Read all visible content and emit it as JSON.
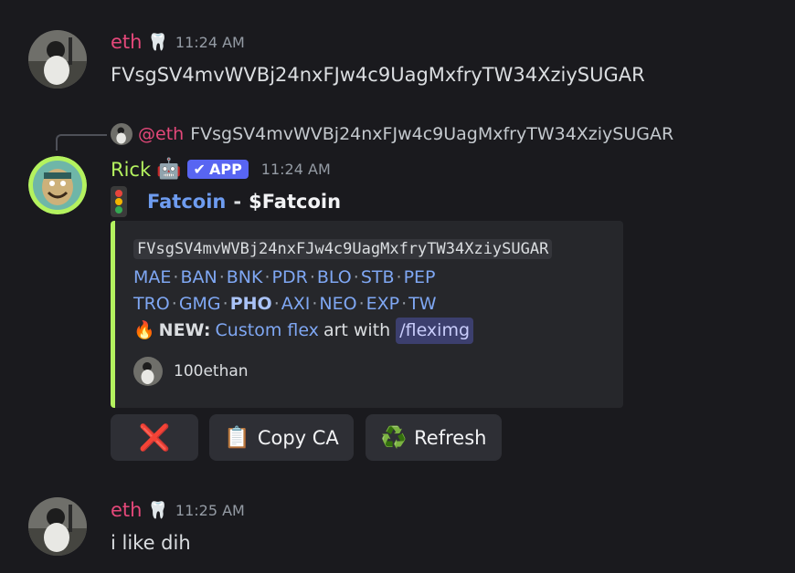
{
  "messages": [
    {
      "author": "eth",
      "author_color": "#e5487a",
      "badge_icon": "braces-emoji",
      "badge_glyph": "🦷",
      "timestamp": "11:24 AM",
      "text": "FVsgSV4mvWVBj24nxFJw4c9UagMxfryTW34XziySUGAR"
    },
    {
      "reply_to": {
        "mention": "@eth",
        "text": "FVsgSV4mvWVBj24nxFJw4c9UagMxfryTW34XziySUGAR"
      },
      "author": "Rick",
      "author_color": "#b4f25f",
      "badge_icon": "robot-emoji",
      "badge_glyph": "🤖",
      "app_badge": "APP",
      "timestamp": "11:24 AM",
      "title": {
        "icon": "traffic-light-icon",
        "token_name": "Fatcoin",
        "dash": "-",
        "ticker": "$Fatcoin"
      },
      "embed": {
        "accent": "#b4f25f",
        "contract_address": "FVsgSV4mvWVBj24nxFJw4c9UagMxfryTW34XziySUGAR",
        "links_row1": [
          "MAE",
          "BAN",
          "BNK",
          "PDR",
          "BLO",
          "STB",
          "PEP"
        ],
        "links_row2": [
          "TRO",
          "GMG",
          "PHO",
          "AXI",
          "NEO",
          "EXP",
          "TW"
        ],
        "separator": "·",
        "new_icon": "fire-emoji",
        "new_glyph": "🔥",
        "new_label": "NEW:",
        "new_link": "Custom flex",
        "new_text": "art with",
        "new_command": "/fleximg",
        "footer_author": "100ethan"
      },
      "buttons": [
        {
          "icon": "close-icon",
          "glyph": "❌",
          "label": ""
        },
        {
          "icon": "clipboard-icon",
          "glyph": "📋",
          "label": "Copy CA"
        },
        {
          "icon": "recycle-icon",
          "glyph": "♻️",
          "label": "Refresh"
        }
      ]
    },
    {
      "author": "eth",
      "author_color": "#e5487a",
      "badge_icon": "braces-emoji",
      "badge_glyph": "🦷",
      "timestamp": "11:25 AM",
      "text": "i like dih"
    }
  ]
}
